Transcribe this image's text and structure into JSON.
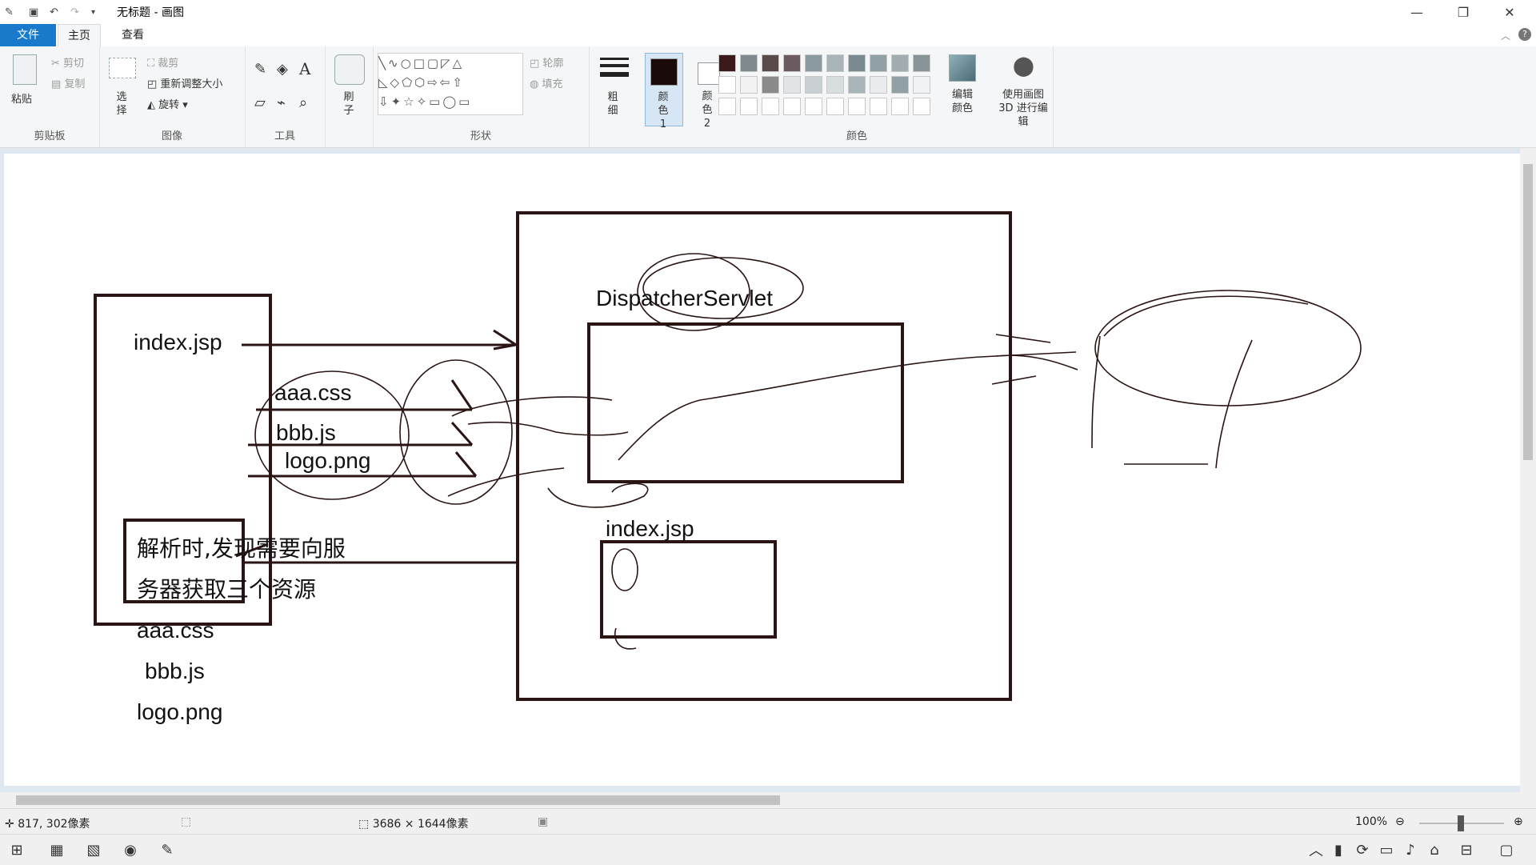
{
  "window": {
    "title": "无标题 - 画图",
    "minimize": "—",
    "maximize": "❐",
    "close": "✕"
  },
  "menu": {
    "tabs": [
      {
        "label": "文件"
      },
      {
        "label": "主页"
      },
      {
        "label": "查看"
      }
    ]
  },
  "ribbon": {
    "clipboard": {
      "label": "剪贴板",
      "paste": "粘贴",
      "cut": "剪切",
      "copy": "复制"
    },
    "image": {
      "label": "图像",
      "select": "选择",
      "crop": "裁剪",
      "resize": "重新调整大小",
      "rotate": "旋转"
    },
    "tools": {
      "label": "工具"
    },
    "brushes": {
      "label": "刷子"
    },
    "shapes": {
      "label": "形状",
      "outline": "轮廓",
      "fill": "填充"
    },
    "size": {
      "label": "粗细"
    },
    "colors": {
      "label": "颜色",
      "color1": "颜色 1",
      "color2": "颜色 2",
      "edit": "编辑颜色",
      "color1_value": "#1a0a0a",
      "color2_value": "#ffffff",
      "palette_row1": [
        "#3a1a1a",
        "#7f8a8f",
        "#5b4a4a",
        "#6b5a5f",
        "#8a9aa0",
        "#a8b4b8",
        "#7a8a90",
        "#90a0a5",
        "#a0acb0",
        "#889498"
      ],
      "palette_row2": [
        "#ffffff",
        "#f2f2f2",
        "#8a8a8a",
        "#e0e4e6",
        "#c8d0d4",
        "#d8dde0",
        "#a8b4b8",
        "#e8ecee",
        "#90a0a5",
        "#f0f2f3"
      ]
    },
    "paint3d": {
      "label": "使用画图 3D 进行编辑"
    }
  },
  "drawing": {
    "left_box_title": "index.jsp",
    "resource_items": [
      "aaa.css",
      "bbb.js",
      "logo.png"
    ],
    "note_line1": "解析时,发现需要向服",
    "note_line2": "务器获取三个资源",
    "bottom_list": [
      "aaa.css",
      "bbb.js",
      "logo.png"
    ],
    "servlet_label": "DispatcherServlet",
    "inner_jsp_label": "index.jsp"
  },
  "status": {
    "cursor_pos": "817, 302像素",
    "image_size": "3686 × 1644像素",
    "zoom": "100%"
  }
}
